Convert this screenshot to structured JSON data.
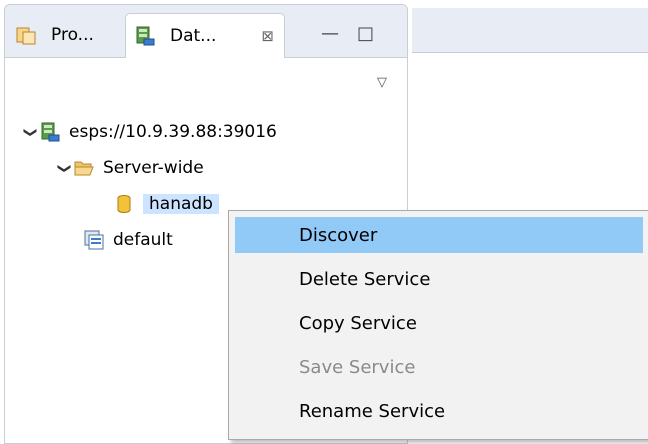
{
  "tabs": [
    {
      "label": "Pro...",
      "active": false
    },
    {
      "label": "Dat...",
      "active": true,
      "close_glyph": "⊠"
    }
  ],
  "window_buttons": {
    "minimize": "—",
    "maximize": "□"
  },
  "view_menu_glyph": "▽",
  "tree": {
    "server": {
      "label": "esps://10.9.39.88:39016",
      "expanded": true
    },
    "folder": {
      "label": "Server-wide",
      "expanded": true
    },
    "service": {
      "label": "hanadb",
      "selected": true
    },
    "workspace": {
      "label": "default"
    }
  },
  "context_menu": {
    "items": [
      {
        "label": "Discover",
        "highlighted": true,
        "enabled": true
      },
      {
        "label": "Delete Service",
        "enabled": true
      },
      {
        "label": "Copy Service",
        "enabled": true
      },
      {
        "label": "Save Service",
        "enabled": false
      },
      {
        "label": "Rename Service",
        "enabled": true
      }
    ]
  },
  "colors": {
    "highlight": "#91c9f7",
    "selection": "#cce4ff",
    "disabled_text": "#8a8a8a",
    "tabbar_bg": "#e8ecf4"
  }
}
